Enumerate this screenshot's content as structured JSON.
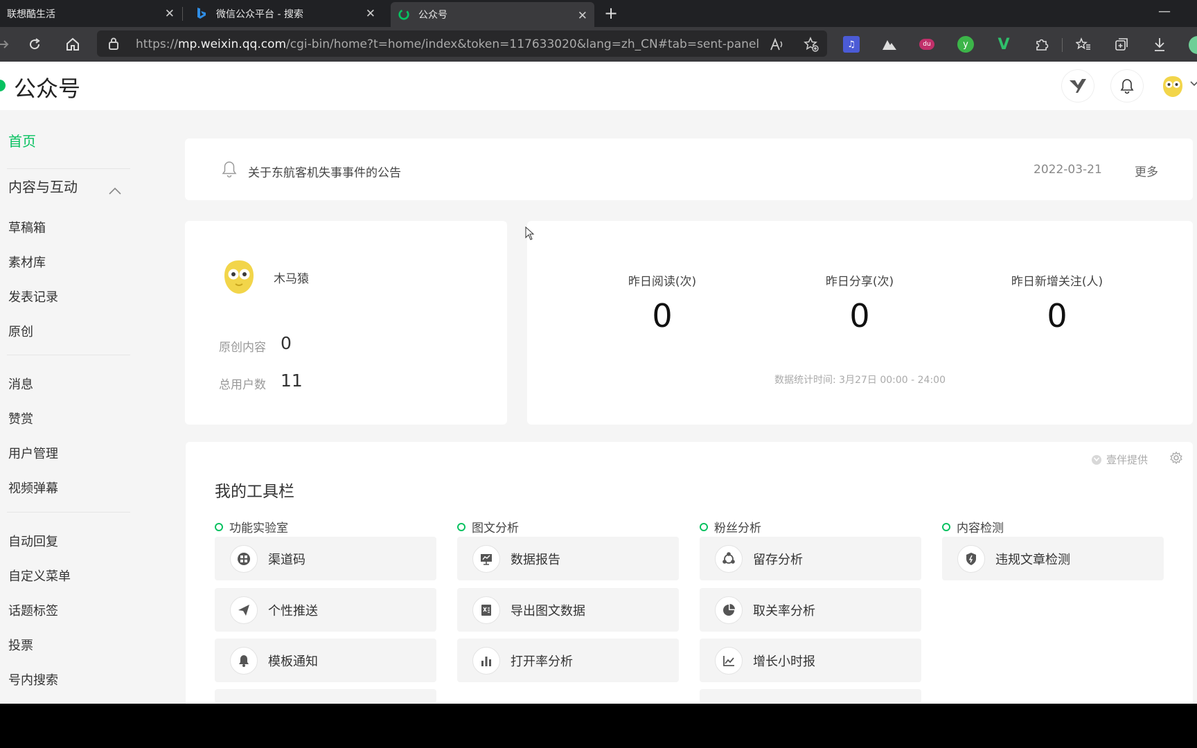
{
  "browser": {
    "tabs": [
      {
        "title": "联想酷生活",
        "close": "✕"
      },
      {
        "title": "微信公众平台 - 搜索",
        "close": "✕"
      },
      {
        "title": "公众号",
        "close": "✕"
      }
    ],
    "new_tab": "+",
    "minimize": "—",
    "url_prefix": "https://",
    "url_host": "mp.weixin.qq.com",
    "url_path": "/cgi-bin/home?t=home/index&token=117633020&lang=zh_CN#tab=sent-panel"
  },
  "header": {
    "brand": "公众号"
  },
  "sidebar": {
    "home": "首页",
    "section_content": "内容与互动",
    "items_content": [
      "草稿箱",
      "素材库",
      "发表记录",
      "原创"
    ],
    "items_interact": [
      "消息",
      "赞赏",
      "用户管理",
      "视频弹幕"
    ],
    "items_more": [
      "自动回复",
      "自定义菜单",
      "话题标签",
      "投票",
      "号内搜索"
    ]
  },
  "notice": {
    "text": "关于东航客机失事事件的公告",
    "date": "2022-03-21",
    "more": "更多"
  },
  "account": {
    "name": "木马猿",
    "original_label": "原创内容",
    "original_value": "0",
    "users_label": "总用户数",
    "users_value": "11"
  },
  "stats": {
    "metrics": [
      {
        "label": "昨日阅读(次)",
        "value": "0"
      },
      {
        "label": "昨日分享(次)",
        "value": "0"
      },
      {
        "label": "昨日新增关注(人)",
        "value": "0"
      }
    ],
    "footnote": "数据统计时间: 3月27日 00:00 - 24:00"
  },
  "tools": {
    "provider": "壹伴提供",
    "title": "我的工具栏",
    "groups": [
      {
        "name": "功能实验室",
        "items": [
          "渠道码",
          "个性推送",
          "模板通知"
        ]
      },
      {
        "name": "图文分析",
        "items": [
          "数据报告",
          "导出图文数据",
          "打开率分析"
        ]
      },
      {
        "name": "粉丝分析",
        "items": [
          "留存分析",
          "取关率分析",
          "增长小时报"
        ]
      },
      {
        "name": "内容检测",
        "items": [
          "违规文章检测"
        ]
      }
    ]
  },
  "colors": {
    "accent": "#07c160",
    "page_bg": "#f5f5f5",
    "chrome_bg": "#202124"
  }
}
